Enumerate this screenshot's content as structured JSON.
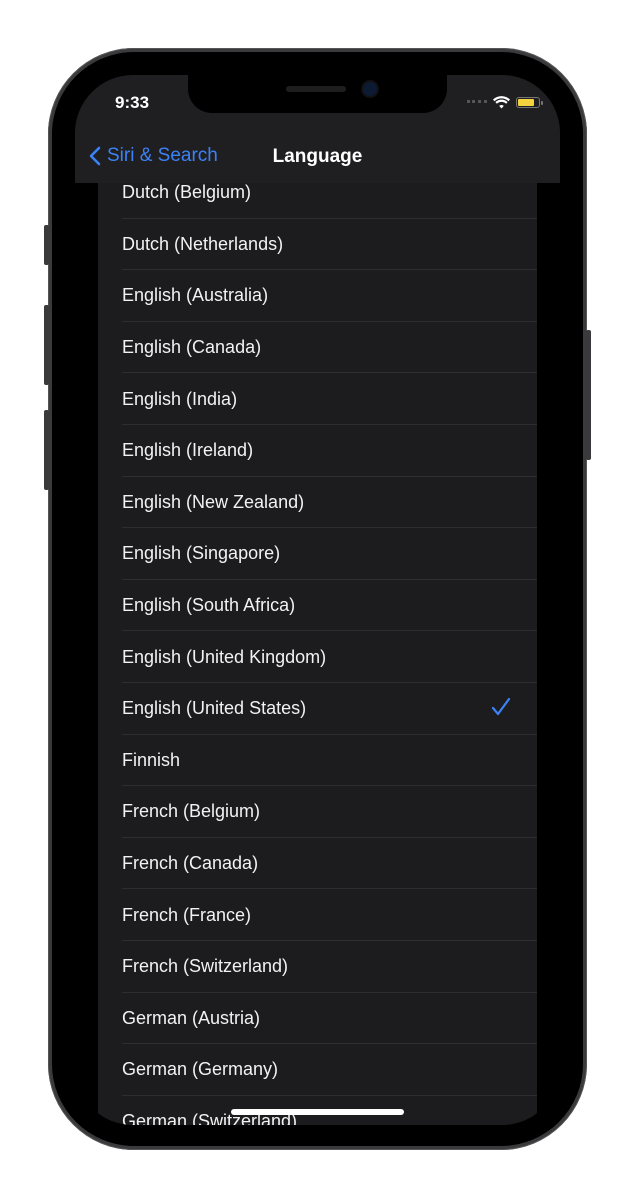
{
  "status_bar": {
    "time": "9:33"
  },
  "nav": {
    "back_label": "Siri & Search",
    "title": "Language"
  },
  "languages": [
    {
      "label": "Dutch (Belgium)",
      "selected": false
    },
    {
      "label": "Dutch (Netherlands)",
      "selected": false
    },
    {
      "label": "English (Australia)",
      "selected": false
    },
    {
      "label": "English (Canada)",
      "selected": false
    },
    {
      "label": "English (India)",
      "selected": false
    },
    {
      "label": "English (Ireland)",
      "selected": false
    },
    {
      "label": "English (New Zealand)",
      "selected": false
    },
    {
      "label": "English (Singapore)",
      "selected": false
    },
    {
      "label": "English (South Africa)",
      "selected": false
    },
    {
      "label": "English (United Kingdom)",
      "selected": false
    },
    {
      "label": "English (United States)",
      "selected": true
    },
    {
      "label": "Finnish",
      "selected": false
    },
    {
      "label": "French (Belgium)",
      "selected": false
    },
    {
      "label": "French (Canada)",
      "selected": false
    },
    {
      "label": "French (France)",
      "selected": false
    },
    {
      "label": "French (Switzerland)",
      "selected": false
    },
    {
      "label": "German (Austria)",
      "selected": false
    },
    {
      "label": "German (Germany)",
      "selected": false
    },
    {
      "label": "German (Switzerland)",
      "selected": false
    }
  ],
  "colors": {
    "accent": "#3b82f6",
    "cell_bg": "#1c1c1e",
    "battery": "#f5d33f"
  }
}
